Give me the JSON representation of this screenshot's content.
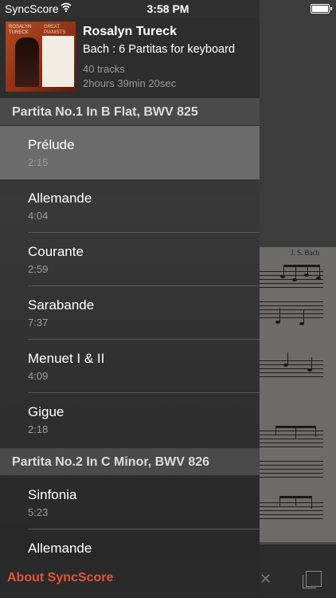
{
  "status_bar": {
    "carrier": "SyncScore",
    "time": "3:58 PM"
  },
  "album": {
    "artist": "Rosalyn Tureck",
    "title": "Bach : 6 Partitas for keyboard",
    "tracks": "40 tracks",
    "duration": "2hours 39min 20sec",
    "cover_artist_text": "ROSALYN\nTURECK",
    "cover_series_text": "GREAT\nPIANISTS"
  },
  "sections": [
    {
      "label": "Partita No.1 In B Flat, BWV 825",
      "tracks": [
        {
          "title": "Prélude",
          "time": "2:15",
          "selected": true
        },
        {
          "title": "Allemande",
          "time": "4:04"
        },
        {
          "title": "Courante",
          "time": "2:59"
        },
        {
          "title": "Sarabande",
          "time": "7:37"
        },
        {
          "title": "Menuet I & II",
          "time": "4:09"
        },
        {
          "title": "Gigue",
          "time": "2:18"
        }
      ]
    },
    {
      "label": "Partita No.2 In C Minor, BWV 826",
      "tracks": [
        {
          "title": "Sinfonia",
          "time": "5:23"
        },
        {
          "title": "Allemande",
          "time": ""
        }
      ]
    }
  ],
  "score": {
    "credit": "J. S. Bach"
  },
  "footer": {
    "about_label": "About SyncScore"
  },
  "colors": {
    "accent": "#e5533b",
    "selected_row": "#6b6b6b",
    "section_header": "#4a4a4a"
  }
}
